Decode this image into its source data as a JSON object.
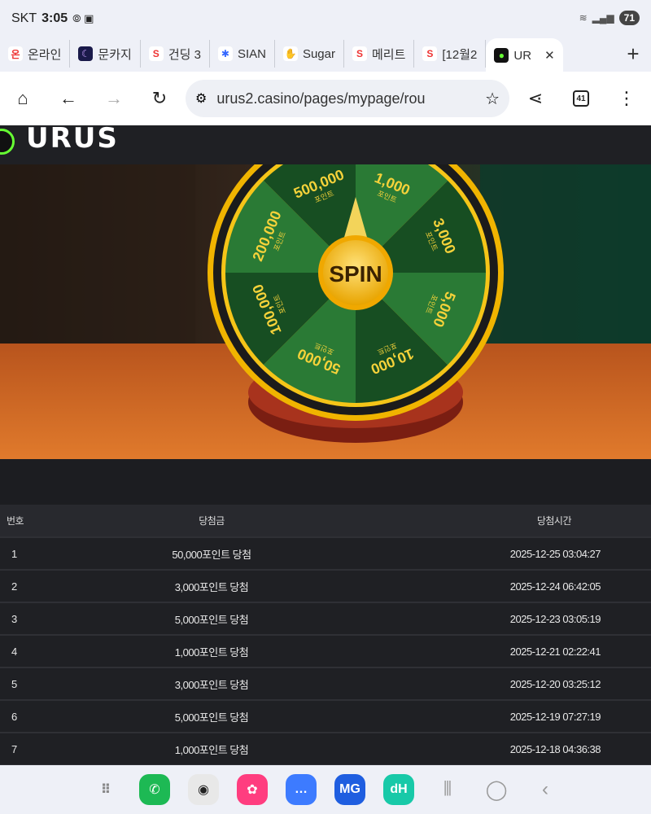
{
  "status": {
    "carrier": "SKT",
    "time": "3:05",
    "battery": "71"
  },
  "tabs": [
    {
      "label": "온라인",
      "fav_bg": "#ffffff",
      "fav_color": "#e33",
      "fav": "온"
    },
    {
      "label": "문카지",
      "fav_bg": "#1a1a4a",
      "fav_color": "#c9a0ff",
      "fav": "☾"
    },
    {
      "label": "건딩 3",
      "fav_bg": "#ffffff",
      "fav_color": "#e33",
      "fav": "S"
    },
    {
      "label": "SIAN",
      "fav_bg": "#ffffff",
      "fav_color": "#3366ff",
      "fav": "✱"
    },
    {
      "label": "Sugar",
      "fav_bg": "#ffffff",
      "fav_color": "#f90",
      "fav": "✋"
    },
    {
      "label": "메리트",
      "fav_bg": "#ffffff",
      "fav_color": "#e33",
      "fav": "S"
    },
    {
      "label": "[12월2",
      "fav_bg": "#ffffff",
      "fav_color": "#e33",
      "fav": "S"
    },
    {
      "label": "UR",
      "fav_bg": "#111111",
      "fav_color": "#6f3",
      "fav": "●"
    }
  ],
  "toolbar": {
    "url": "urus2.casino/pages/mypage/rou",
    "tab_count": "41"
  },
  "site": {
    "logo": "URUS"
  },
  "wheel": {
    "center": "SPIN",
    "segments": [
      {
        "amount": "1,000",
        "unit": "포인트"
      },
      {
        "amount": "3,000",
        "unit": "포인트"
      },
      {
        "amount": "5,000",
        "unit": "포인트"
      },
      {
        "amount": "10,000",
        "unit": "포인트"
      },
      {
        "amount": "50,000",
        "unit": "포인트"
      },
      {
        "amount": "100,000",
        "unit": "포인트"
      },
      {
        "amount": "200,000",
        "unit": "포인트"
      },
      {
        "amount": "500,000",
        "unit": "포인트"
      }
    ]
  },
  "table": {
    "headers": {
      "num": "번호",
      "prize": "당첨금",
      "time": "당첨시간"
    },
    "rows": [
      {
        "num": "1",
        "prize": "50,000포인트 당첨",
        "time": "2025-12-25 03:04:27"
      },
      {
        "num": "2",
        "prize": "3,000포인트 당첨",
        "time": "2025-12-24 06:42:05"
      },
      {
        "num": "3",
        "prize": "5,000포인트 당첨",
        "time": "2025-12-23 03:05:19"
      },
      {
        "num": "4",
        "prize": "1,000포인트 당첨",
        "time": "2025-12-21 02:22:41"
      },
      {
        "num": "5",
        "prize": "3,000포인트 당첨",
        "time": "2025-12-20 03:25:12"
      },
      {
        "num": "6",
        "prize": "5,000포인트 당첨",
        "time": "2025-12-19 07:27:19"
      },
      {
        "num": "7",
        "prize": "1,000포인트 당첨",
        "time": "2025-12-18 04:36:38"
      }
    ]
  },
  "dock": [
    {
      "name": "apps-grid-icon",
      "glyph": "⠿",
      "bg": "transparent",
      "color": "#888"
    },
    {
      "name": "phone-app-icon",
      "glyph": "✆",
      "bg": "#1db954",
      "color": "#fff"
    },
    {
      "name": "camera-app-icon",
      "glyph": "◉",
      "bg": "#e8e8e8",
      "color": "#222"
    },
    {
      "name": "gallery-app-icon",
      "glyph": "✿",
      "bg": "#ff3d7f",
      "color": "#fff"
    },
    {
      "name": "messages-app-icon",
      "glyph": "…",
      "bg": "#3d7bff",
      "color": "#fff"
    },
    {
      "name": "mg-app-icon",
      "glyph": "MG",
      "bg": "#1f5ee0",
      "color": "#fff"
    },
    {
      "name": "dh-app-icon",
      "glyph": "dH",
      "bg": "#18c9a8",
      "color": "#fff"
    }
  ]
}
